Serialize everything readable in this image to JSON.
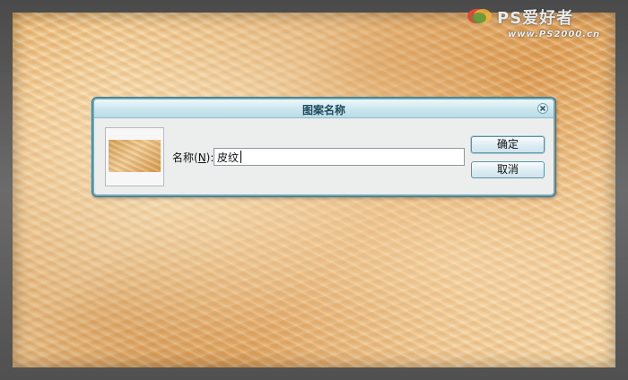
{
  "dialog": {
    "title": "图案名称",
    "name_label_prefix": "名称(",
    "name_label_key": "N",
    "name_label_suffix": "):",
    "name_value": "皮纹",
    "ok_label": "确定",
    "cancel_label": "取消"
  },
  "watermark": {
    "title": "PS爱好者",
    "url": "www.PS2000.cn"
  },
  "colors": {
    "dialog_border": "#6ea7b8",
    "titlebar": "#cde7ef",
    "fur_base": "#e9b873"
  }
}
